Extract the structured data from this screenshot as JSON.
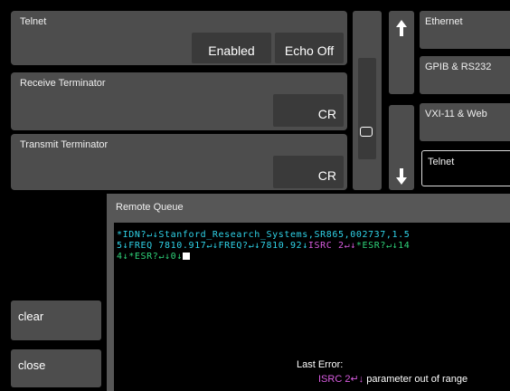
{
  "telnet": {
    "title": "Telnet",
    "enabled_label": "Enabled",
    "echo_label": "Echo Off"
  },
  "receive_terminator": {
    "title": "Receive Terminator",
    "value": "CR"
  },
  "transmit_terminator": {
    "title": "Transmit Terminator",
    "value": "CR"
  },
  "navigation": {
    "up_icon": "arrow-up-icon",
    "down_icon": "arrow-down-icon",
    "scroll_handle": "scroll-handle"
  },
  "tabs": [
    {
      "label": "Ethernet",
      "active": false
    },
    {
      "label": "GPIB & RS232",
      "active": false
    },
    {
      "label": "VXI-11 & Web",
      "active": false
    },
    {
      "label": "Telnet",
      "active": true
    }
  ],
  "sidebar": {
    "clear_label": "clear",
    "close_label": "close"
  },
  "queue": {
    "title": "Remote Queue",
    "lines": [
      [
        {
          "text": "*IDN?↵↓",
          "color": "#2fd3e8"
        },
        {
          "text": "Stanford_Research_Systems,SR865,002737,1.5",
          "color": "#2fd3e8"
        }
      ],
      [
        {
          "text": "5↓",
          "color": "#2fd3e8"
        },
        {
          "text": "FREQ 7810.917↵↓FREQ?↵↓7810.92↓",
          "color": "#2fd3e8"
        },
        {
          "text": "ISRC 2↵↓",
          "color": "#d85ce0"
        },
        {
          "text": "*ESR?↵↓14",
          "color": "#2fd37a"
        }
      ],
      [
        {
          "text": "4↓",
          "color": "#2fd37a"
        },
        {
          "text": "*ESR?↵↓0↓",
          "color": "#2fd37a"
        }
      ]
    ],
    "last_error_label": "Last Error:",
    "error_command": "ISRC 2↵↓",
    "error_message": " parameter out of range",
    "colors": {
      "idn": "#2fd3e8",
      "error": "#d85ce0",
      "esr": "#2fd37a"
    }
  }
}
